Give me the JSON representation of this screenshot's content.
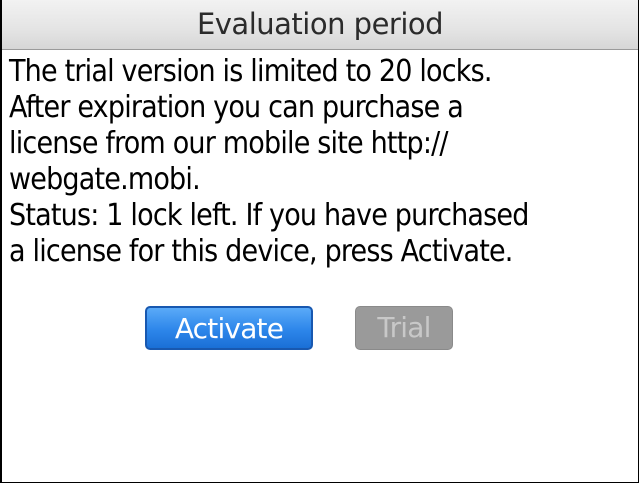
{
  "window": {
    "title": "Evaluation period"
  },
  "message": {
    "lines": [
      "The trial version is limited to 20 locks.",
      "After expiration you can purchase a",
      "license from our mobile site http://",
      "webgate.mobi.",
      "Status: 1 lock left. If you have purchased",
      "a license for this device, press Activate."
    ]
  },
  "buttons": {
    "activate_label": "Activate",
    "trial_label": "Trial"
  },
  "colors": {
    "activate_button": "#2d86ea",
    "trial_button_disabled": "#9a9a9a"
  }
}
